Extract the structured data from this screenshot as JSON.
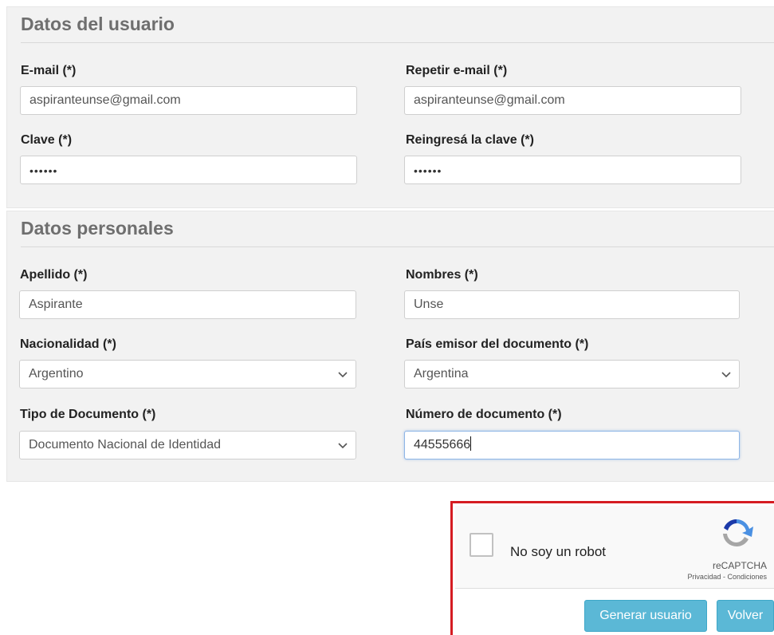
{
  "user_section": {
    "title": "Datos del usuario",
    "email_label": "E-mail (*)",
    "email_value": "aspiranteunse@gmail.com",
    "repeat_email_label": "Repetir e-mail (*)",
    "repeat_email_value": "aspiranteunse@gmail.com",
    "password_label": "Clave (*)",
    "password_value": "••••••",
    "repeat_password_label": "Reingresá la clave (*)",
    "repeat_password_value": "••••••"
  },
  "personal_section": {
    "title": "Datos personales",
    "surname_label": "Apellido (*)",
    "surname_value": "Aspirante",
    "names_label": "Nombres (*)",
    "names_value": "Unse",
    "nationality_label": "Nacionalidad (*)",
    "nationality_value": "Argentino",
    "issuing_country_label": "País emisor del documento (*)",
    "issuing_country_value": "Argentina",
    "doc_type_label": "Tipo de Documento (*)",
    "doc_type_value": "Documento Nacional de Identidad",
    "doc_number_label": "Número de documento (*)",
    "doc_number_value": "44555666"
  },
  "captcha": {
    "checkbox_label": "No soy un robot",
    "brand": "reCAPTCHA",
    "links": "Privacidad - Condiciones"
  },
  "actions": {
    "generate_label": "Generar usuario",
    "back_label": "Volver"
  },
  "colors": {
    "panel_bg": "#f2f2f2",
    "button_bg": "#5bb8d6",
    "captcha_border": "#d51c22"
  }
}
